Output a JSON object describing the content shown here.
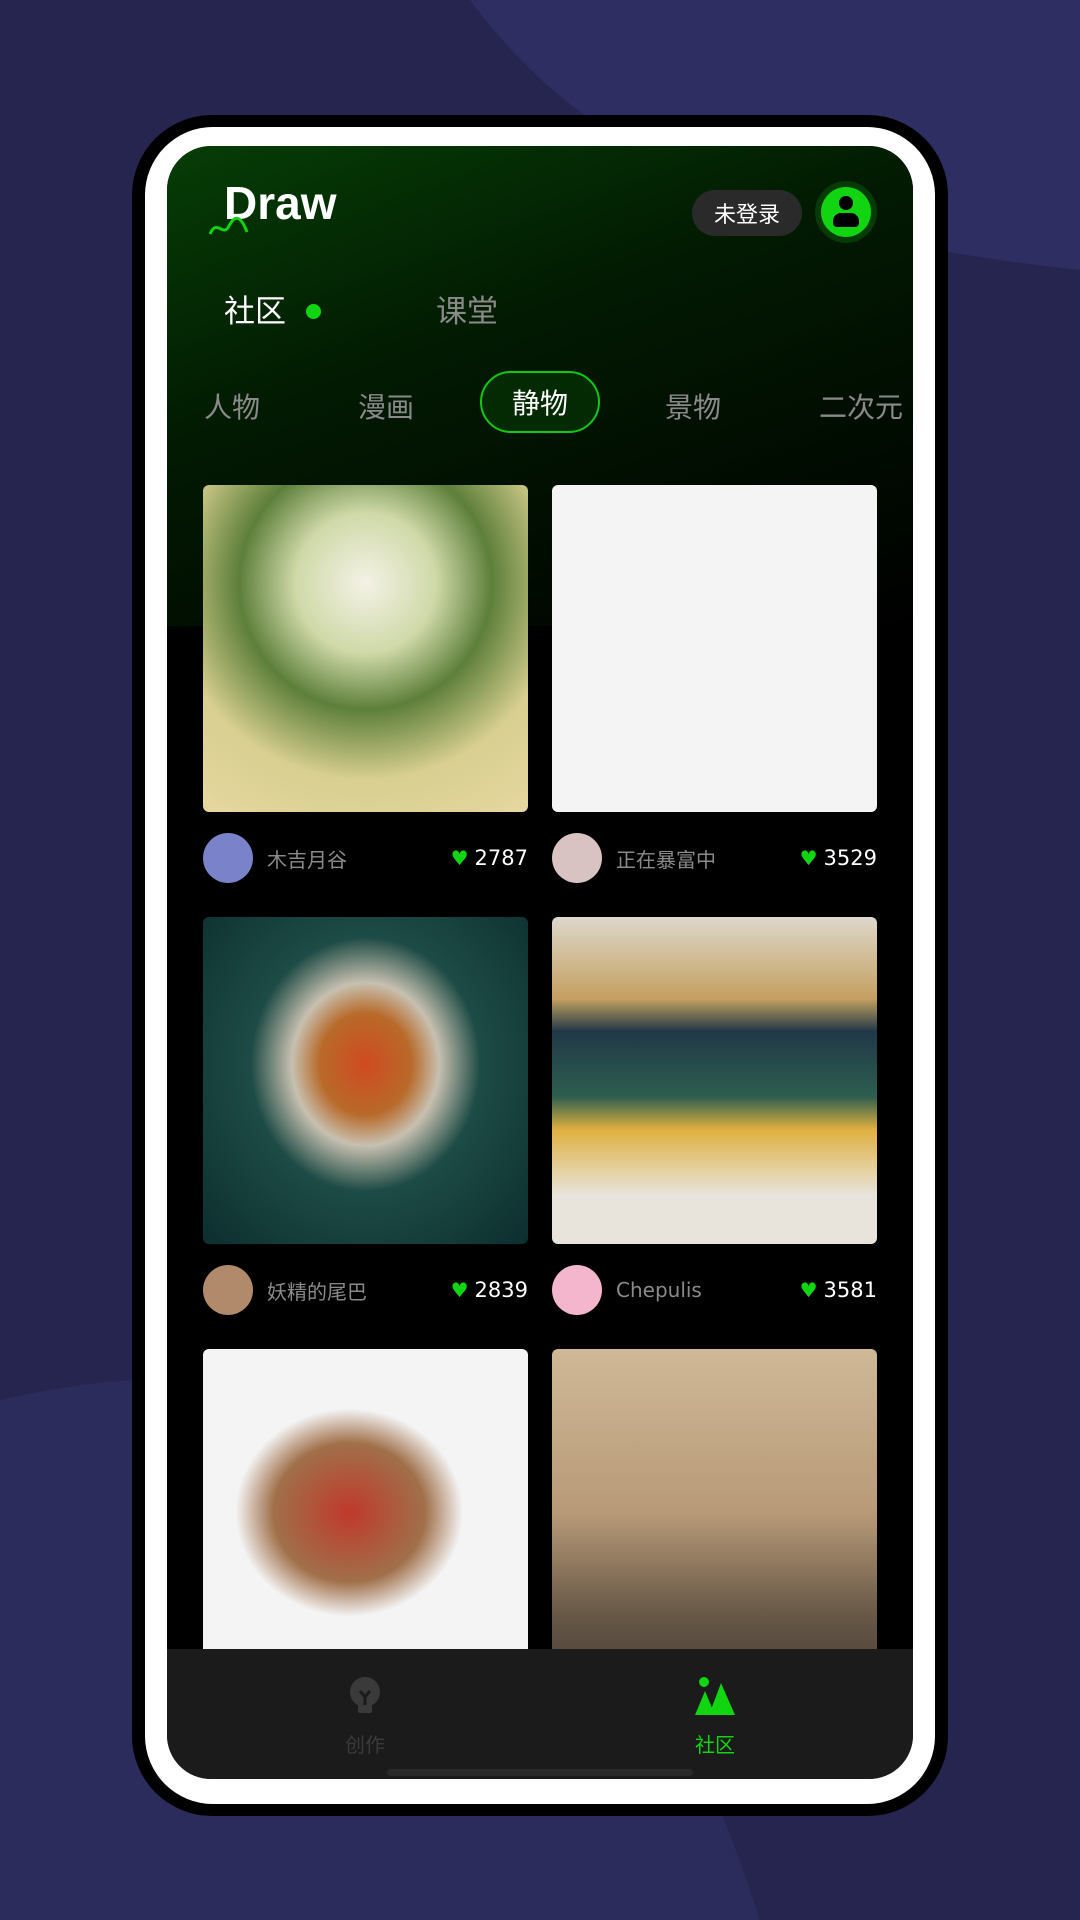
{
  "header": {
    "logo": "Draw",
    "login_label": "未登录"
  },
  "main_tabs": [
    {
      "label": "社区",
      "active": true
    },
    {
      "label": "课堂",
      "active": false
    }
  ],
  "categories": [
    {
      "label": "人物"
    },
    {
      "label": "漫画"
    },
    {
      "label": "静物",
      "active": true
    },
    {
      "label": "景物"
    },
    {
      "label": "二次元"
    }
  ],
  "posts": [
    {
      "user": "木吉月谷",
      "likes": "2787"
    },
    {
      "user": "正在暴富中",
      "likes": "3529"
    },
    {
      "user": "妖精的尾巴",
      "likes": "2839"
    },
    {
      "user": "Chepulis",
      "likes": "3581"
    },
    {
      "user": "",
      "likes": ""
    },
    {
      "user": "",
      "likes": ""
    }
  ],
  "bottom_nav": [
    {
      "label": "创作",
      "icon": "lightbulb-icon",
      "active": false
    },
    {
      "label": "社区",
      "icon": "community-icon",
      "active": true
    }
  ],
  "colors": {
    "accent": "#10d510",
    "background": "#25254f",
    "nav": "#1b1b1b"
  }
}
